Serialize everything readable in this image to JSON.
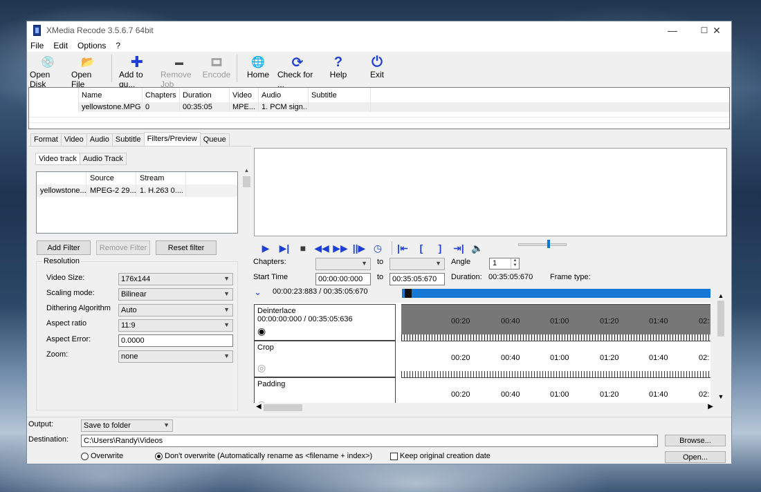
{
  "window": {
    "title": "XMedia Recode 3.5.6.7 64bit",
    "minimize": "—",
    "maximize": "☐",
    "close": "✕"
  },
  "menu": [
    "File",
    "Edit",
    "Options",
    "?"
  ],
  "toolbar": [
    {
      "label": "Open Disk",
      "icon": "disc-icon",
      "glyph": "💿",
      "enabled": true
    },
    {
      "label": "Open File",
      "icon": "folder-icon",
      "glyph": "📂",
      "enabled": true
    },
    {
      "label": "Add to qu...",
      "icon": "plus-icon",
      "glyph": "✚",
      "enabled": true
    },
    {
      "label": "Remove Job",
      "icon": "minus-icon",
      "glyph": "▬",
      "enabled": false
    },
    {
      "label": "Encode",
      "icon": "encode-icon",
      "glyph": "🎞",
      "enabled": false
    },
    {
      "label": "Home",
      "icon": "globe-icon",
      "glyph": "🌐",
      "enabled": true
    },
    {
      "label": "Check for ...",
      "icon": "refresh-icon",
      "glyph": "⟳",
      "enabled": true
    },
    {
      "label": "Help",
      "icon": "question-icon",
      "glyph": "?",
      "enabled": true
    },
    {
      "label": "Exit",
      "icon": "power-icon",
      "glyph": "⏻",
      "enabled": true
    }
  ],
  "filelist": {
    "columns": [
      "",
      "Name",
      "Chapters",
      "Duration",
      "Video",
      "Audio",
      "Subtitle"
    ],
    "rows": [
      [
        "",
        "yellowstone.MPG",
        "0",
        "00:35:05",
        "MPE...",
        "1. PCM sign...",
        ""
      ]
    ]
  },
  "tabs": [
    "Format",
    "Video",
    "Audio",
    "Subtitle",
    "Filters/Preview",
    "Queue"
  ],
  "active_tab": "Filters/Preview",
  "subtabs": [
    "Video track",
    "Audio Track"
  ],
  "tracklist": {
    "columns": [
      "",
      "Source",
      "Stream"
    ],
    "rows": [
      [
        "yellowstone....",
        "MPEG-2 29....",
        "1. H.263 0...."
      ]
    ]
  },
  "filter_buttons": {
    "add": "Add Filter",
    "remove": "Remove Filter",
    "reset": "Reset filter"
  },
  "resolution": {
    "group_label": "Resolution",
    "video_size_label": "Video Size:",
    "video_size": "176x144",
    "scaling_label": "Scaling mode:",
    "scaling": "Bilinear",
    "dither_label": "Dithering Algorithm",
    "dither": "Auto",
    "aspect_label": "Aspect ratio",
    "aspect": "11:9",
    "aspect_error_label": "Aspect Error:",
    "aspect_error": "0.0000",
    "zoom_label": "Zoom:",
    "zoom": "none"
  },
  "preview": {
    "chapters_label": "Chapters:",
    "to_label": "to",
    "angle_label": "Angle",
    "angle": "1",
    "start_label": "Start Time",
    "start": "00:00:00:000",
    "end": "00:35:05:670",
    "duration_label": "Duration:",
    "duration": "00:35:05:670",
    "frame_type_label": "Frame type:",
    "position": "00:00:23:883 / 00:35:05:670"
  },
  "timeline": {
    "ticks": [
      "00:20",
      "00:40",
      "01:00",
      "01:20",
      "01:40",
      "02:"
    ],
    "filters": [
      {
        "name": "Deinterlace",
        "range": "00:00:00:000 / 00:35:05:636",
        "active": true
      },
      {
        "name": "Crop",
        "range": "",
        "active": false
      },
      {
        "name": "Padding",
        "range": "",
        "active": false
      }
    ]
  },
  "bottom": {
    "output_label": "Output:",
    "output": "Save to folder",
    "destination_label": "Destination:",
    "destination": "C:\\Users\\Randy\\Videos",
    "browse": "Browse...",
    "open": "Open...",
    "overwrite": "Overwrite",
    "dont_overwrite": "Don't overwrite (Automatically rename as <filename + index>)",
    "keep_date": "Keep original creation date"
  },
  "colors": {
    "accent": "#1478d4",
    "play_blue": "#1e3fd6"
  }
}
